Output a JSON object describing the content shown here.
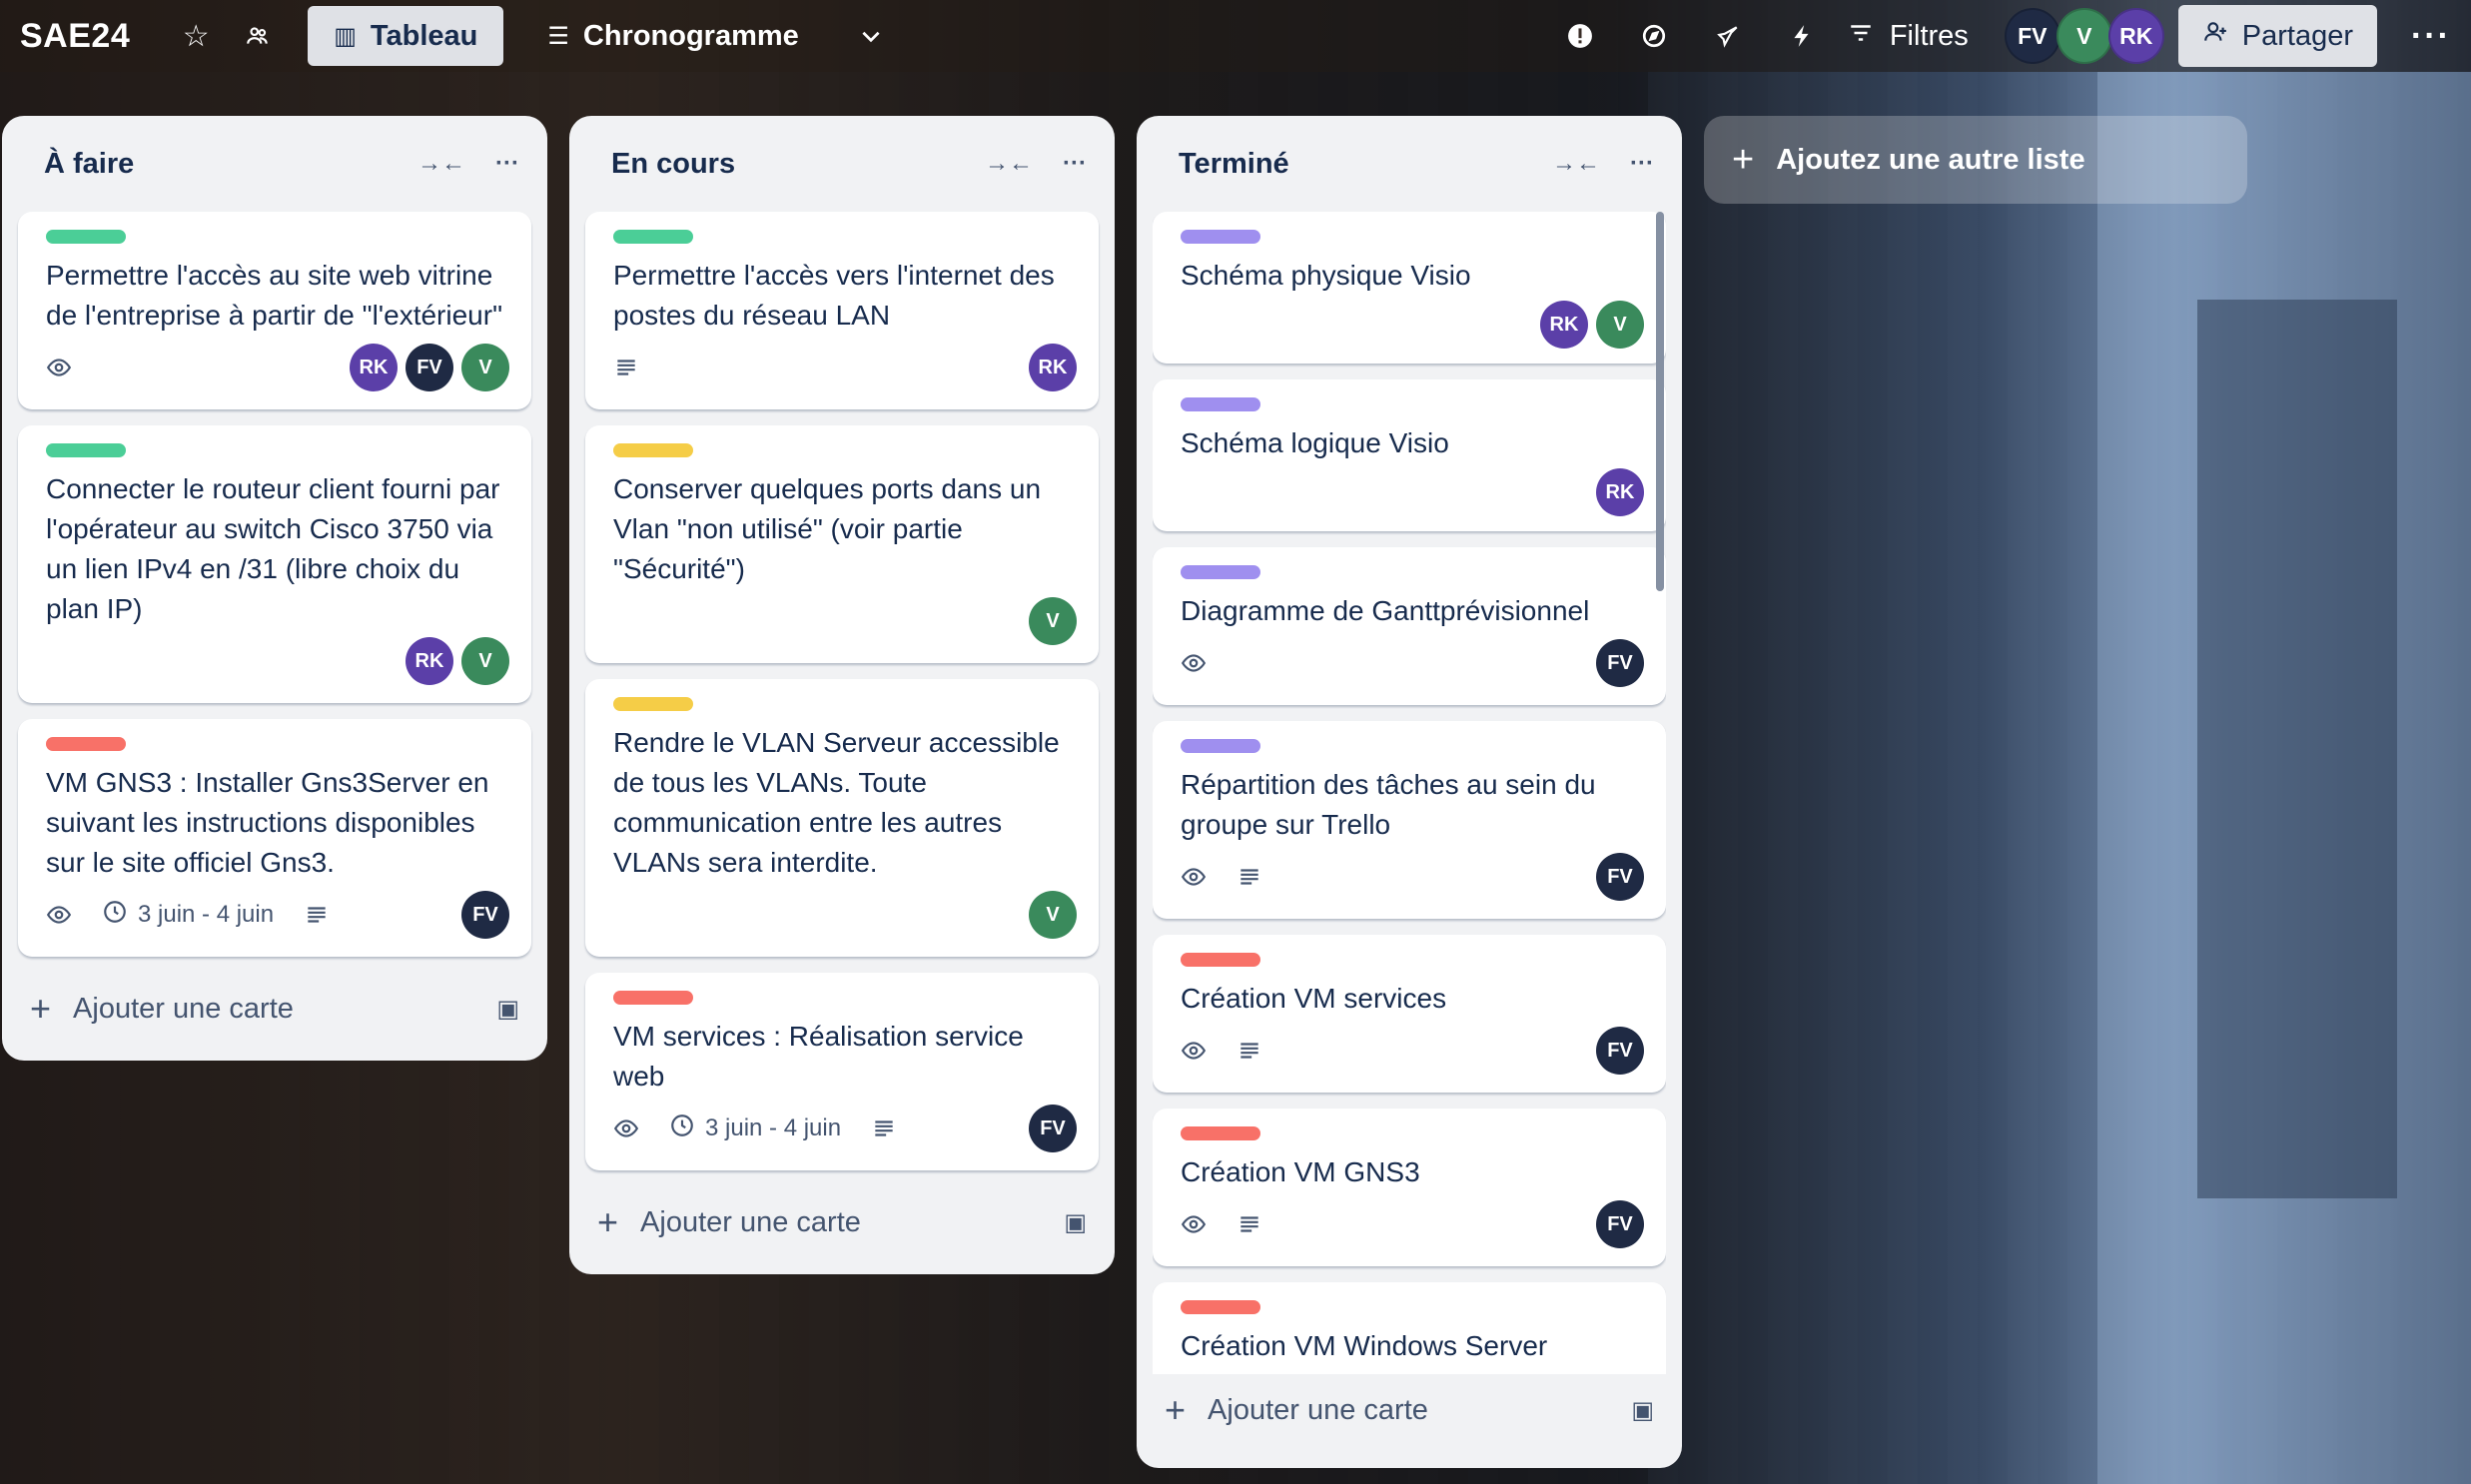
{
  "board": {
    "title": "SAE24",
    "views": [
      {
        "label": "Tableau",
        "active": true
      },
      {
        "label": "Chronogramme",
        "active": false
      }
    ],
    "filter_label": "Filtres",
    "share_label": "Partager",
    "members": [
      {
        "initials": "FV",
        "color": "#1f2a44"
      },
      {
        "initials": "V",
        "color": "#3a8a5c"
      },
      {
        "initials": "RK",
        "color": "#5b3fa8"
      }
    ]
  },
  "lists": [
    {
      "title": "À faire",
      "add_card_label": "Ajouter une carte",
      "cards": [
        {
          "label_color": "green",
          "title": "Permettre l'accès au site web vitrine de l'entreprise à partir de \"l'extérieur\"",
          "watch": true,
          "date": "",
          "description": false,
          "members": [
            "RK",
            "FV",
            "V"
          ]
        },
        {
          "label_color": "green",
          "title": "Connecter le routeur client fourni par l'opérateur au switch Cisco 3750 via un lien IPv4 en /31 (libre choix du plan IP)",
          "watch": false,
          "date": "",
          "description": false,
          "members": [
            "RK",
            "V"
          ]
        },
        {
          "label_color": "red",
          "title": "VM GNS3 : Installer Gns3Server en suivant les instructions disponibles sur le site officiel Gns3.",
          "watch": true,
          "date": "3 juin - 4 juin",
          "description": true,
          "members": [
            "FV"
          ]
        }
      ]
    },
    {
      "title": "En cours",
      "add_card_label": "Ajouter une carte",
      "cards": [
        {
          "label_color": "green",
          "title": "Permettre l'accès vers l'internet des postes du réseau LAN",
          "watch": false,
          "date": "",
          "description": true,
          "members": [
            "RK"
          ]
        },
        {
          "label_color": "yellow",
          "title": "Conserver quelques ports dans un Vlan \"non utilisé\" (voir partie \"Sécurité\")",
          "watch": false,
          "date": "",
          "description": false,
          "members": [
            "V"
          ]
        },
        {
          "label_color": "yellow",
          "title": "Rendre le VLAN Serveur accessible de tous les VLANs. Toute communication entre les autres VLANs sera interdite.",
          "watch": false,
          "date": "",
          "description": false,
          "members": [
            "V"
          ]
        },
        {
          "label_color": "red",
          "title": "VM services : Réalisation service web",
          "watch": true,
          "date": "3 juin - 4 juin",
          "description": true,
          "members": [
            "FV"
          ]
        }
      ]
    },
    {
      "title": "Terminé",
      "add_card_label": "Ajouter une carte",
      "cards": [
        {
          "label_color": "purple",
          "title": "Schéma physique Visio",
          "watch": false,
          "date": "",
          "description": false,
          "members": [
            "RK",
            "V"
          ]
        },
        {
          "label_color": "purple",
          "title": "Schéma logique Visio",
          "watch": false,
          "date": "",
          "description": false,
          "members": [
            "RK"
          ]
        },
        {
          "label_color": "purple",
          "title": "Diagramme de Ganttprévisionnel",
          "watch": true,
          "date": "",
          "description": false,
          "members": [
            "FV"
          ]
        },
        {
          "label_color": "purple",
          "title": "Répartition des tâches au sein du groupe sur Trello",
          "watch": true,
          "date": "",
          "description": true,
          "members": [
            "FV"
          ]
        },
        {
          "label_color": "red",
          "title": "Création VM services",
          "watch": true,
          "date": "",
          "description": true,
          "members": [
            "FV"
          ]
        },
        {
          "label_color": "red",
          "title": "Création VM GNS3",
          "watch": true,
          "date": "",
          "description": true,
          "members": [
            "FV"
          ]
        },
        {
          "label_color": "red",
          "title": "Création VM Windows Server",
          "watch": false,
          "date": "",
          "description": false,
          "members": []
        }
      ]
    }
  ],
  "add_list_label": "Ajoutez une autre liste",
  "colors": {
    "green": "#4bce97",
    "yellow": "#f5cd47",
    "red": "#f87168",
    "purple": "#9f8fef"
  }
}
